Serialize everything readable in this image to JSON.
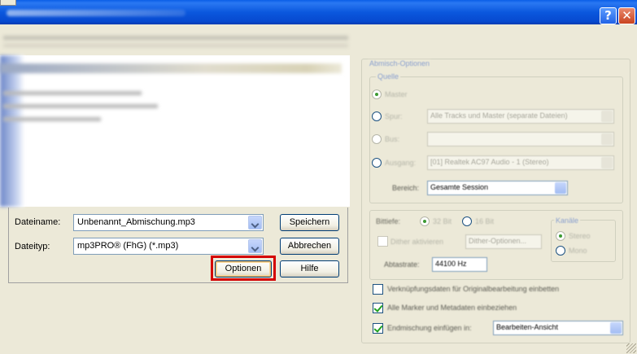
{
  "titlebar": {
    "help_glyph": "?",
    "close_glyph": "✕"
  },
  "save": {
    "filename_label": "Dateiname:",
    "filename_value": "Unbenannt_Abmischung.mp3",
    "filetype_label": "Dateityp:",
    "filetype_value": "mp3PRO® (FhG) (*.mp3)",
    "save_button": "Speichern",
    "cancel_button": "Abbrechen",
    "options_button": "Optionen",
    "help_button": "Hilfe"
  },
  "mix_options": {
    "group_title": "Abmisch-Optionen",
    "source_title": "Quelle",
    "master_label": "Master",
    "track_label": "Spur:",
    "track_value": "Alle Tracks und Master (separate Dateien)",
    "bus_label": "Bus:",
    "bus_value": "",
    "output_label": "Ausgang:",
    "output_value": "[01] Realtek AC97 Audio - 1 (Stereo)",
    "range_label": "Bereich:",
    "range_value": "Gesamte Session",
    "bitdepth_label": "Bittiefe:",
    "bit32_label": "32 Bit",
    "bit16_label": "16 Bit",
    "dither_label": "Dither aktivieren",
    "dither_options_button": "Dither-Optionen...",
    "samplerate_label": "Abtastrate:",
    "samplerate_value": "44100 Hz",
    "channels_title": "Kanäle",
    "stereo_label": "Stereo",
    "mono_label": "Mono",
    "embed_label": "Verknüpfungsdaten für Originalbearbeitung einbetten",
    "markers_label": "Alle Marker und Metadaten einbeziehen",
    "insert_label": "Endmischung einfügen in:",
    "insert_value": "Bearbeiten-Ansicht"
  },
  "colors": {
    "highlight_frame": "#d40000",
    "titlebar": "#0b58de"
  }
}
